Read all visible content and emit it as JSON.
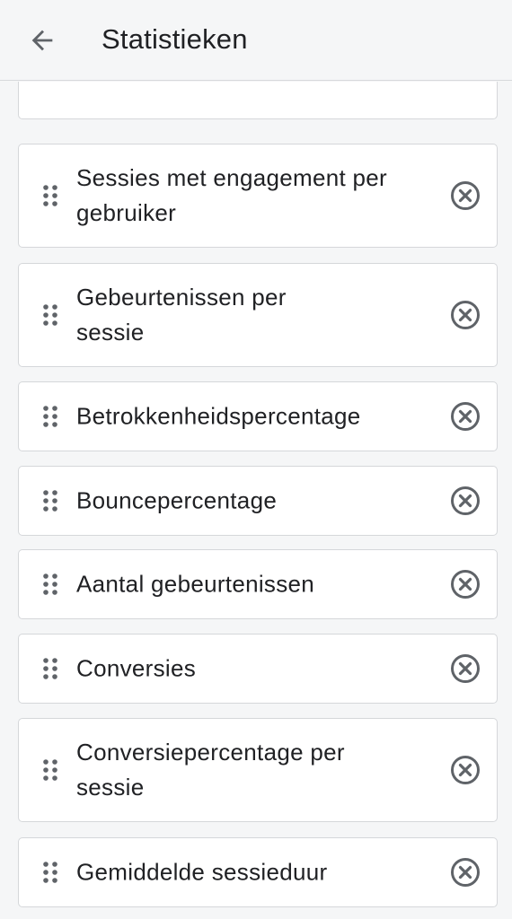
{
  "app_bar": {
    "back_icon": "arrow-left-icon",
    "title": "Statistieken"
  },
  "metrics": [
    {
      "label": "Sessies met engagement per gebruiker"
    },
    {
      "label": "Gebeurtenissen per sessie"
    },
    {
      "label": "Betrokkenheidspercentage"
    },
    {
      "label": "Bouncepercentage"
    },
    {
      "label": "Aantal gebeurtenissen"
    },
    {
      "label": "Conversies"
    },
    {
      "label": "Conversiepercentage per sessie"
    },
    {
      "label": "Gemiddelde sessieduur"
    }
  ],
  "icons": {
    "drag": "drag-handle-icon",
    "remove": "remove-circle-icon"
  },
  "colors": {
    "background": "#f5f6f7",
    "card": "#ffffff",
    "border": "#d5d7da",
    "text": "#202124",
    "icon": "#5f6368"
  }
}
